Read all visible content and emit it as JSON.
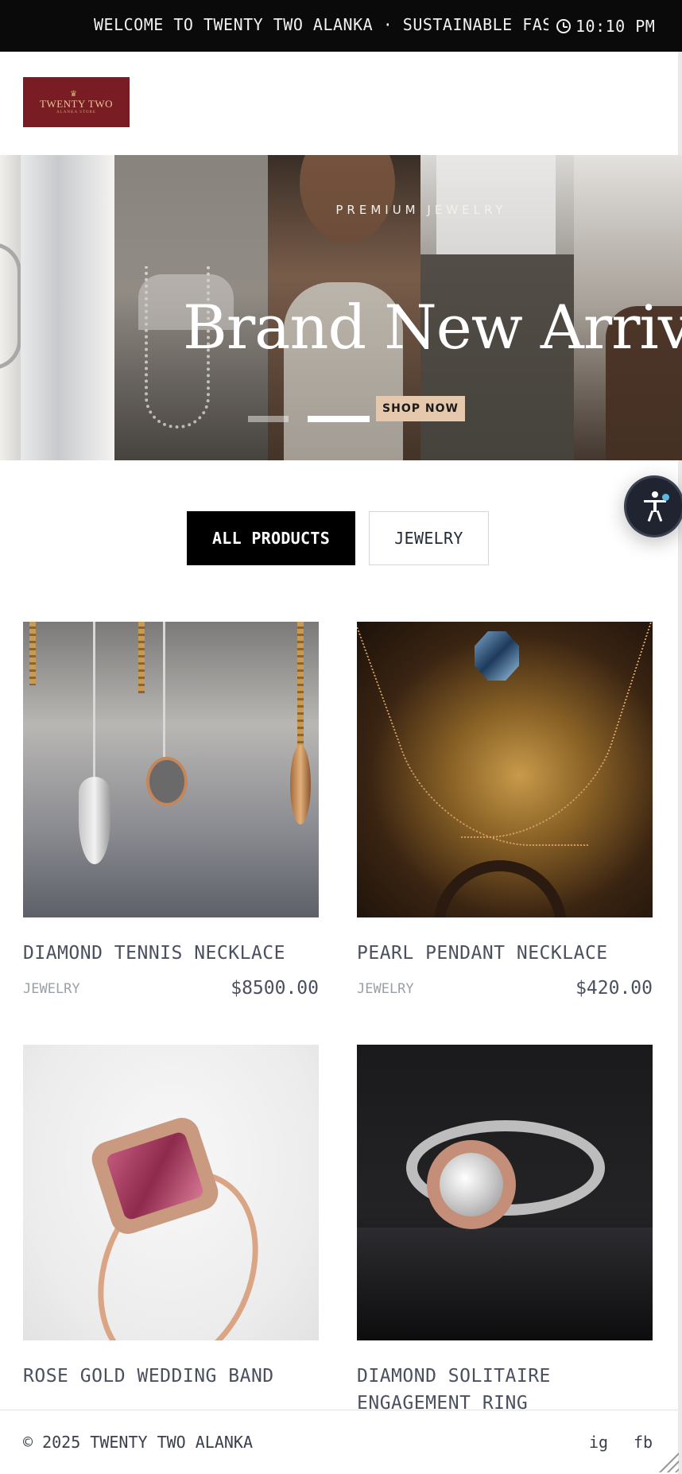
{
  "topbar": {
    "announcement": "WELCOME TO TWENTY TWO ALANKA · SUSTAINABLE FASHION",
    "time": "10:10 PM",
    "icon": "clock-icon"
  },
  "brand": {
    "logo_name": "TWENTY TWO",
    "logo_tag": "ALANKA STORE",
    "logo_color": "#7a1c24"
  },
  "hero": {
    "eyebrow": "PREMIUM JEWELRY",
    "headline": "Brand New Arrival",
    "cta": "SHOP NOW",
    "slide_count": 2,
    "active_slide": 2
  },
  "filters": {
    "all": "ALL PRODUCTS",
    "jewelry": "JEWELRY",
    "active": "ALL PRODUCTS"
  },
  "products": [
    {
      "name": "DIAMOND TENNIS NECKLACE",
      "category": "JEWELRY",
      "price": "$8500.00"
    },
    {
      "name": "PEARL PENDANT NECKLACE",
      "category": "JEWELRY",
      "price": "$420.00"
    },
    {
      "name": "ROSE GOLD WEDDING BAND",
      "category": "",
      "price": ""
    },
    {
      "name": "DIAMOND SOLITAIRE ENGAGEMENT RING",
      "category": "",
      "price": ""
    }
  ],
  "footer": {
    "copyright": "© 2025 TWENTY TWO ALANKA",
    "instagram": "ig",
    "facebook": "fb"
  },
  "colors": {
    "accent_black": "#000000",
    "cta_bg": "#e6c9ad",
    "a11y_badge": "#5ab7e6"
  }
}
